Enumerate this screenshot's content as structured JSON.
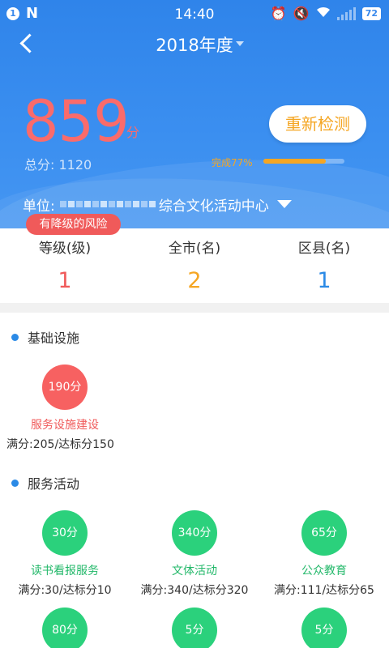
{
  "status_bar": {
    "badge": "1",
    "carrier_mark": "N",
    "time": "14:40",
    "battery": "72"
  },
  "nav": {
    "year_label": "2018年度"
  },
  "summary": {
    "score": "859",
    "score_unit": "分",
    "total_label": "总分:",
    "total_value": "1120",
    "recheck_button": "重新检测",
    "progress_label": "完成77%",
    "progress_percent": 77,
    "unit_prefix": "单位:",
    "unit_name": "综合文化活动中心",
    "risk_badge": "有降级的风险"
  },
  "stats": [
    {
      "label": "等级(级)",
      "value": "1",
      "color": "#f05a5a"
    },
    {
      "label": "全市(名)",
      "value": "2",
      "color": "#f5a623"
    },
    {
      "label": "区县(名)",
      "value": "1",
      "color": "#2b8ae6"
    }
  ],
  "sections": {
    "infrastructure": {
      "title": "基础设施",
      "items": [
        {
          "score": "190分",
          "name": "服务设施建设",
          "meta": "满分:205/达标分150",
          "tone": "red"
        }
      ]
    },
    "activities": {
      "title": "服务活动",
      "items": [
        {
          "score": "30分",
          "name": "读书看报服务",
          "meta": "满分:30/达标分10",
          "tone": "green"
        },
        {
          "score": "340分",
          "name": "文体活动",
          "meta": "满分:340/达标分320",
          "tone": "green"
        },
        {
          "score": "65分",
          "name": "公众教育",
          "meta": "满分:111/达标分65",
          "tone": "green"
        },
        {
          "score": "80分",
          "tone": "green"
        },
        {
          "score": "5分",
          "tone": "green"
        },
        {
          "score": "5分",
          "tone": "green"
        }
      ]
    }
  },
  "colors": {
    "header_blue": "#3b8ff0",
    "score_red": "#fa6b6b",
    "accent_orange": "#f5a623",
    "risk_red": "#f05a5a",
    "good_green": "#2bd17c"
  },
  "icons": [
    "back-arrow-icon",
    "dropdown-caret-icon",
    "alarm-icon",
    "mute-icon",
    "wifi-icon",
    "signal-icon",
    "battery-icon"
  ]
}
